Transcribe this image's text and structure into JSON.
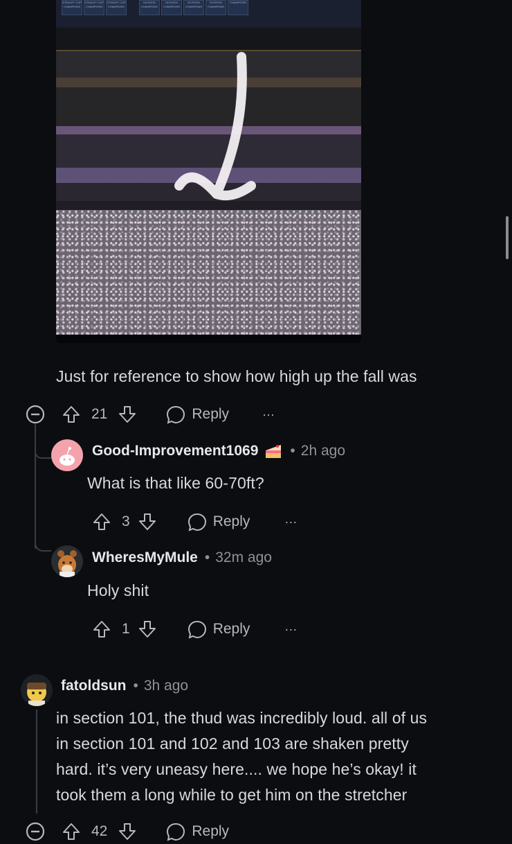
{
  "photo": {
    "banners": [
      "STANLEY CUP CHAMPIONS",
      "STANLEY CUP CHAMPIONS",
      "STANLEY CUP CHAMPIONS",
      "DIVISION CHAMPIONS",
      "DIVISION CHAMPIONS",
      "DIVISION CHAMPIONS",
      "DIVISION CHAMPIONS",
      "CHAMPIONS"
    ]
  },
  "parent_comment": {
    "body": "Just for reference to show how high up the fall was",
    "votes": "21",
    "reply_label": "Reply",
    "more": "···"
  },
  "replies": [
    {
      "username": "Good-Improvement1069",
      "badge": "cake-icon",
      "separator": "•",
      "time": "2h ago",
      "body": "What is that like 60-70ft?",
      "votes": "3",
      "reply_label": "Reply",
      "more": "···"
    },
    {
      "username": "WheresMyMule",
      "separator": "•",
      "time": "32m ago",
      "body": "Holy shit",
      "votes": "1",
      "reply_label": "Reply",
      "more": "···"
    }
  ],
  "comment": {
    "username": "fatoldsun",
    "separator": "•",
    "time": "3h ago",
    "body_lines": [
      "in section 101, the thud was incredibly loud. all of us",
      "in section 101 and 102 and 103 are shaken pretty",
      "hard. it’s very uneasy here.... we hope he’s okay! it",
      "took them a long while to get him on the stretcher"
    ],
    "votes": "42",
    "reply_label": "Reply"
  },
  "colors": {
    "background": "#0b0d10",
    "text": "#d7dadc",
    "muted": "#8e9396",
    "accent_avatar": "#f4a3ad"
  }
}
